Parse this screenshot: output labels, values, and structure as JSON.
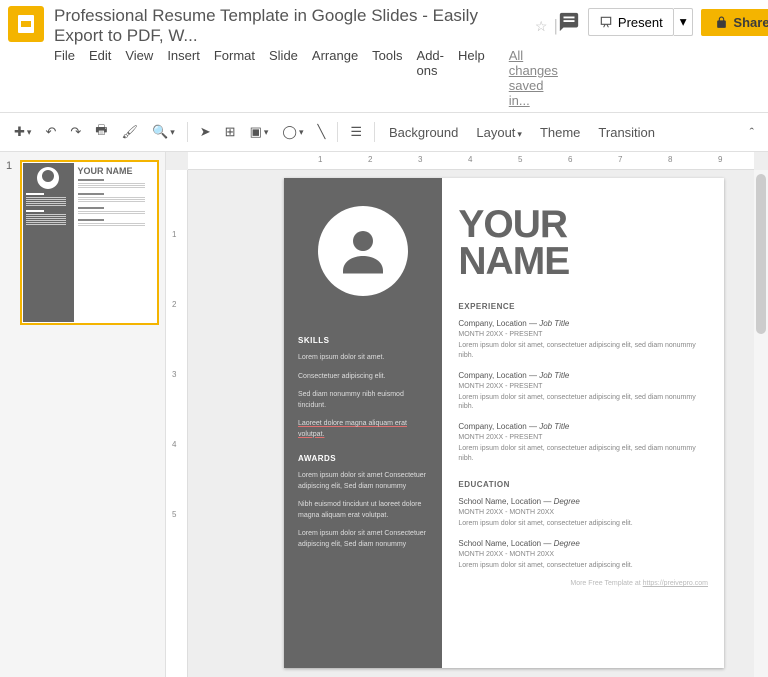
{
  "header": {
    "title": "Professional Resume Template in Google Slides - Easily Export to PDF, W...",
    "saved": "All changes saved in...",
    "present": "Present",
    "share": "Share"
  },
  "menu": [
    "File",
    "Edit",
    "View",
    "Insert",
    "Format",
    "Slide",
    "Arrange",
    "Tools",
    "Add-ons",
    "Help"
  ],
  "toolbar": {
    "background": "Background",
    "layout": "Layout",
    "theme": "Theme",
    "transition": "Transition"
  },
  "thumb": {
    "num": "1",
    "name": "YOUR NAME"
  },
  "ruler_h": [
    "1",
    "2",
    "3",
    "4",
    "5",
    "6",
    "7",
    "8",
    "9"
  ],
  "ruler_v": [
    "1",
    "2",
    "3",
    "4",
    "5"
  ],
  "slide": {
    "name1": "YOUR",
    "name2": "NAME",
    "skills_h": "SKILLS",
    "skills_p1": "Lorem ipsum dolor sit amet.",
    "skills_p2": "Consectetuer adipiscing elit.",
    "skills_p3": "Sed diam nonummy nibh euismod tincidunt.",
    "skills_p4": "Laoreet dolore magna aliquam erat volutpat.",
    "awards_h": "AWARDS",
    "awards_p1": "Lorem ipsum dolor sit amet Consectetuer adipiscing elit, Sed diam nonummy",
    "awards_p2": "Nibh euismod tincidunt ut laoreet dolore magna aliquam erat volutpat.",
    "awards_p3": "Lorem ipsum dolor sit amet Consectetuer adipiscing elit, Sed diam nonummy",
    "exp_h": "EXPERIENCE",
    "exp": [
      {
        "line": "Company, Location — Job Title",
        "date": "MONTH 20XX - PRESENT",
        "body": "Lorem ipsum dolor sit amet, consectetuer adipiscing elit, sed diam nonummy nibh."
      },
      {
        "line": "Company, Location — Job Title",
        "date": "MONTH 20XX - PRESENT",
        "body": "Lorem ipsum dolor sit amet, consectetuer adipiscing elit, sed diam nonummy nibh."
      },
      {
        "line": "Company, Location — Job Title",
        "date": "MONTH 20XX - PRESENT",
        "body": "Lorem ipsum dolor sit amet, consectetuer adipiscing elit, sed diam nonummy nibh."
      }
    ],
    "edu_h": "EDUCATION",
    "edu": [
      {
        "line": "School Name, Location — Degree",
        "date": "MONTH 20XX - MONTH 20XX",
        "body": "Lorem ipsum dolor sit amet, consectetuer adipiscing elit."
      },
      {
        "line": "School Name, Location — Degree",
        "date": "MONTH 20XX - MONTH 20XX",
        "body": "Lorem ipsum dolor sit amet, consectetuer adipiscing elit."
      }
    ],
    "footer_pre": "More Free Template at ",
    "footer_link": "https://preivepro.com"
  }
}
